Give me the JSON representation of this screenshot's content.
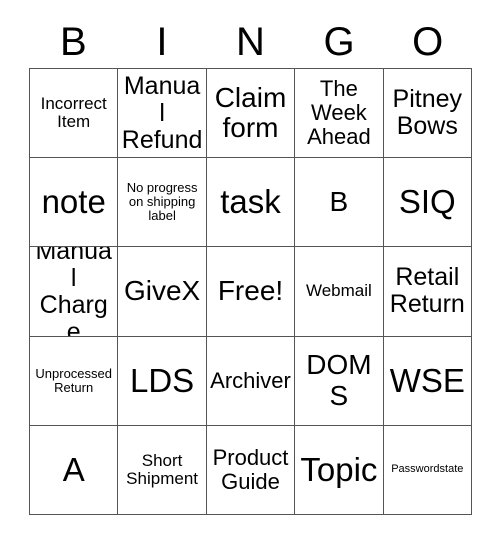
{
  "card": {
    "title": "BINGO",
    "header_letters": [
      "B",
      "I",
      "N",
      "G",
      "O"
    ],
    "colors": {
      "background": "#ffffff",
      "text": "#000000",
      "grid_line": "#555555"
    },
    "grid_size": "5x5",
    "cells": [
      {
        "row": 1,
        "col": 1,
        "text": "Incorrect Item",
        "size": "sm",
        "free": false
      },
      {
        "row": 1,
        "col": 2,
        "text": "Manual Refund",
        "size": "lg",
        "free": false
      },
      {
        "row": 1,
        "col": 3,
        "text": "Claim form",
        "size": "xl",
        "free": false
      },
      {
        "row": 1,
        "col": 4,
        "text": "The Week Ahead",
        "size": "md",
        "free": false
      },
      {
        "row": 1,
        "col": 5,
        "text": "Pitney Bows",
        "size": "lg",
        "free": false
      },
      {
        "row": 2,
        "col": 1,
        "text": "note",
        "size": "xxl",
        "free": false
      },
      {
        "row": 2,
        "col": 2,
        "text": "No progress on shipping label",
        "size": "xs",
        "free": false
      },
      {
        "row": 2,
        "col": 3,
        "text": "task",
        "size": "xxl",
        "free": false
      },
      {
        "row": 2,
        "col": 4,
        "text": "B",
        "size": "xl",
        "free": false
      },
      {
        "row": 2,
        "col": 5,
        "text": "SIQ",
        "size": "xxl",
        "free": false
      },
      {
        "row": 3,
        "col": 1,
        "text": "Manual Charge",
        "size": "lg",
        "free": false
      },
      {
        "row": 3,
        "col": 2,
        "text": "GiveX",
        "size": "xl",
        "free": false
      },
      {
        "row": 3,
        "col": 3,
        "text": "Free!",
        "size": "xl",
        "free": true
      },
      {
        "row": 3,
        "col": 4,
        "text": "Webmail",
        "size": "sm",
        "free": false
      },
      {
        "row": 3,
        "col": 5,
        "text": "Retail Return",
        "size": "lg",
        "free": false
      },
      {
        "row": 4,
        "col": 1,
        "text": "Unprocessed Return",
        "size": "xs",
        "free": false
      },
      {
        "row": 4,
        "col": 2,
        "text": "LDS",
        "size": "xxl",
        "free": false
      },
      {
        "row": 4,
        "col": 3,
        "text": "Archiver",
        "size": "md",
        "free": false
      },
      {
        "row": 4,
        "col": 4,
        "text": "DOMS",
        "size": "xl",
        "free": false
      },
      {
        "row": 4,
        "col": 5,
        "text": "WSE",
        "size": "xxl",
        "free": false
      },
      {
        "row": 5,
        "col": 1,
        "text": "A",
        "size": "xxl",
        "free": false
      },
      {
        "row": 5,
        "col": 2,
        "text": "Short Shipment",
        "size": "sm",
        "free": false
      },
      {
        "row": 5,
        "col": 3,
        "text": "Product Guide",
        "size": "md",
        "free": false
      },
      {
        "row": 5,
        "col": 4,
        "text": "Topic",
        "size": "xxl",
        "free": false
      },
      {
        "row": 5,
        "col": 5,
        "text": "Passwordstate",
        "size": "xxs",
        "free": false
      }
    ]
  }
}
